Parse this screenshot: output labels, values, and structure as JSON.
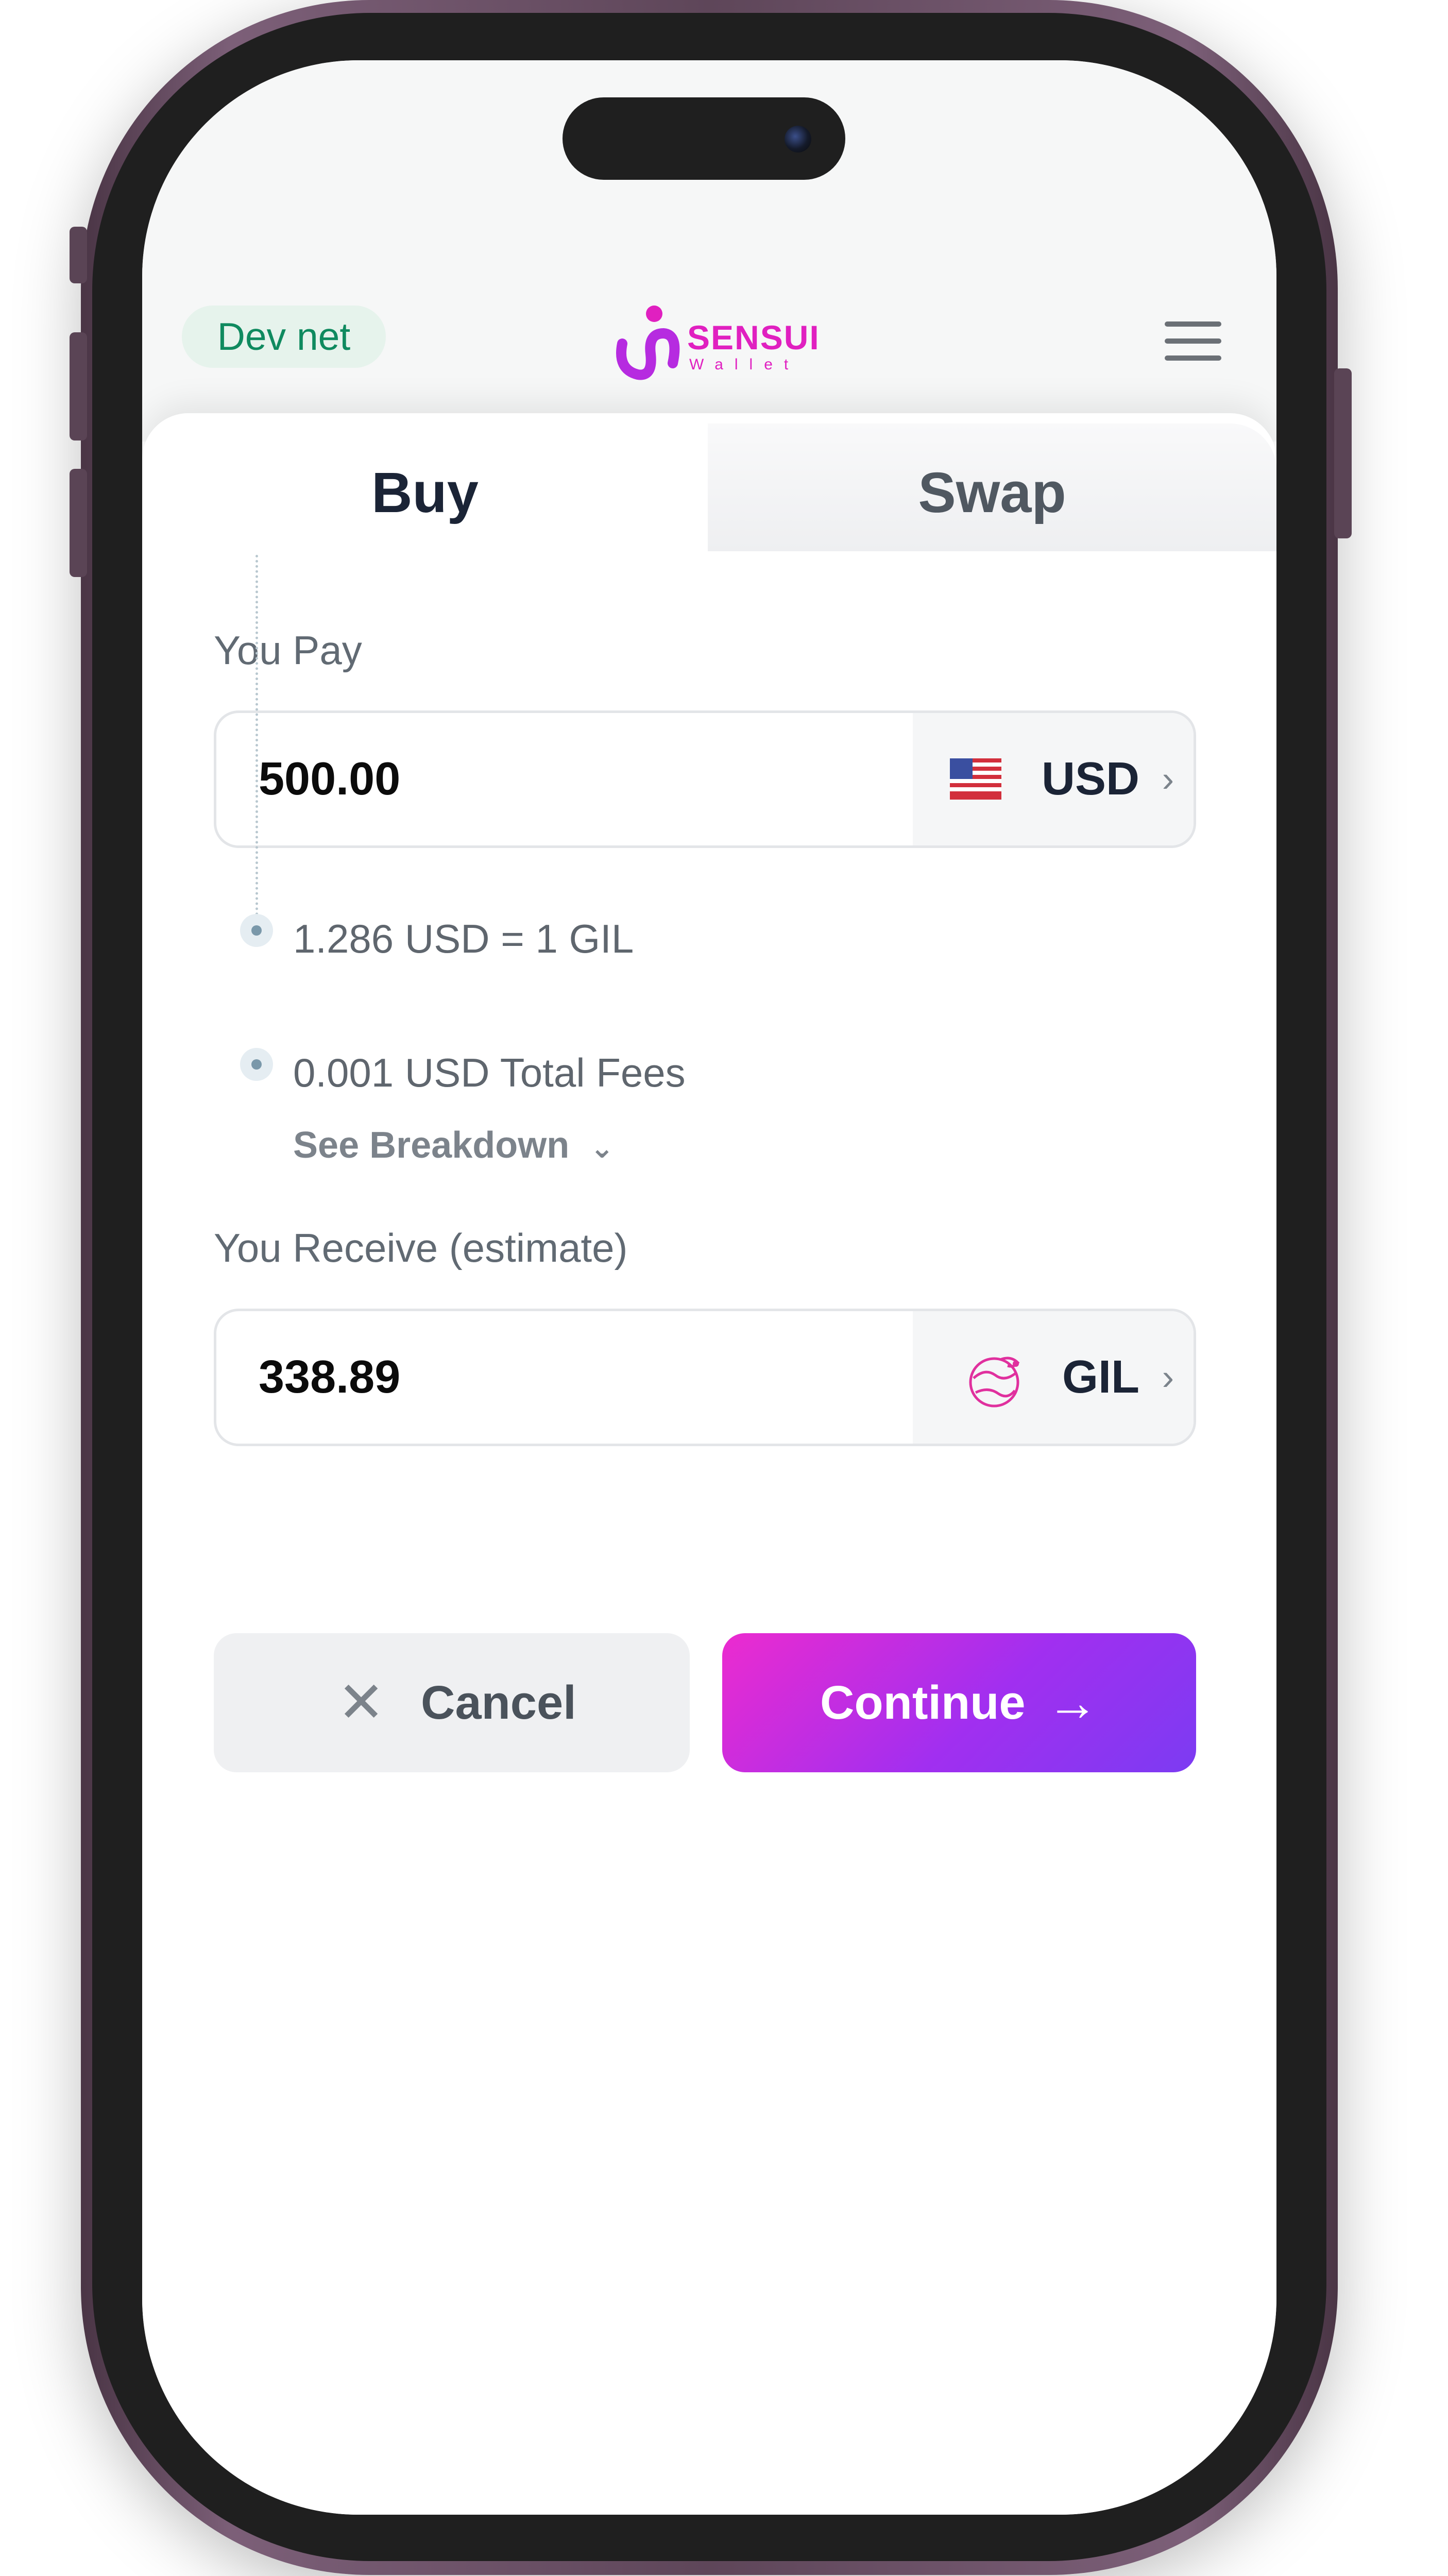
{
  "header": {
    "network_badge": "Dev net",
    "logo_name": "SENSUI",
    "logo_sub": "Wallet",
    "menu_icon": "hamburger-menu-icon"
  },
  "tabs": [
    {
      "label": "Buy",
      "active": true
    },
    {
      "label": "Swap",
      "active": false
    }
  ],
  "pay": {
    "label": "You Pay",
    "amount": "500.00",
    "currency": "USD",
    "currency_icon": "us-flag-icon"
  },
  "details": {
    "rate": "1.286 USD = 1 GIL",
    "fees": "0.001 USD Total Fees",
    "breakdown_link": "See Breakdown"
  },
  "receive": {
    "label": "You Receive (estimate)",
    "amount": "338.89",
    "currency": "GIL",
    "currency_icon": "gil-token-icon"
  },
  "actions": {
    "cancel_label": "Cancel",
    "continue_label": "Continue"
  },
  "colors": {
    "brand_pink": "#e020c0",
    "brand_purple": "#7c3bf2",
    "devnet_green": "#0f8a5f"
  }
}
